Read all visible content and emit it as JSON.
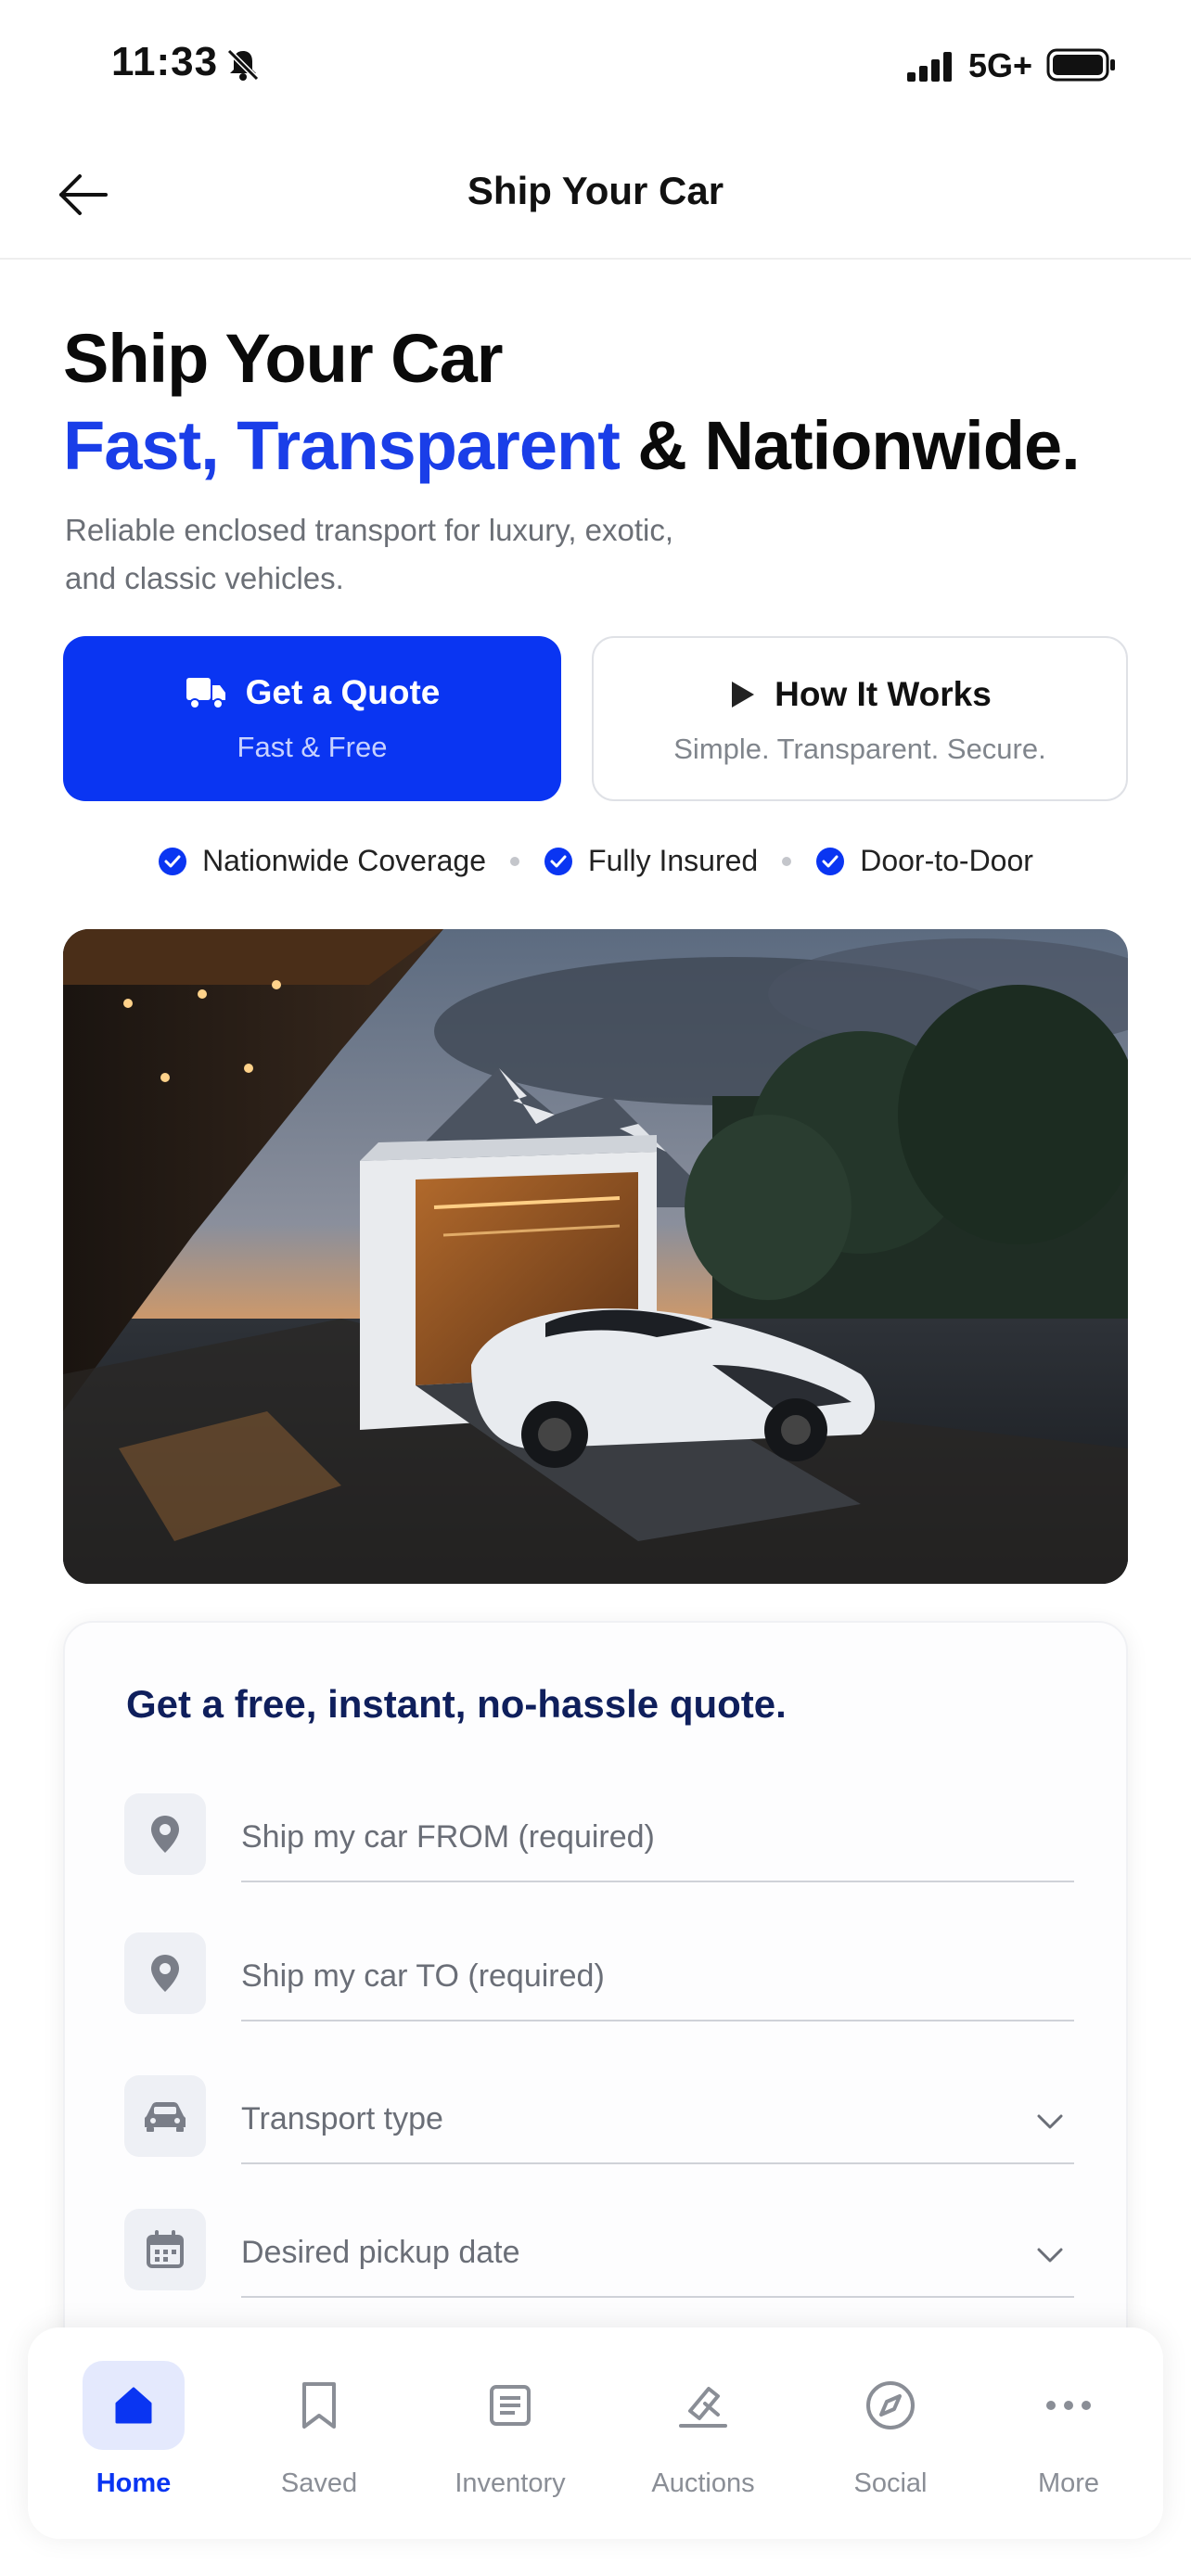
{
  "status": {
    "time": "11:33",
    "network": "5G+"
  },
  "nav": {
    "title": "Ship Your Car"
  },
  "hero": {
    "line1": "Ship Your Car",
    "line2_accent": "Fast, Transparent",
    "line2_rest": " & Nationwide.",
    "subtitle_line1": "Reliable enclosed transport for luxury, exotic,",
    "subtitle_line2": "and classic vehicles."
  },
  "cta": {
    "primary": {
      "label": "Get a Quote",
      "sub": "Fast & Free",
      "icon": "truck-icon"
    },
    "secondary": {
      "label": "How It Works",
      "sub": "Simple. Transparent. Secure.",
      "icon": "play-icon"
    }
  },
  "features": [
    "Nationwide Coverage",
    "Fully Insured",
    "Door-to-Door"
  ],
  "quote_form": {
    "title": "Get a free, instant, no-hassle quote.",
    "fields": [
      {
        "placeholder": "Ship my car FROM (required)",
        "icon": "location-pin-icon"
      },
      {
        "placeholder": "Ship my car TO (required)",
        "icon": "location-pin-icon"
      },
      {
        "placeholder": "Transport type",
        "icon": "car-icon"
      },
      {
        "placeholder": "Desired pickup date",
        "icon": "calendar-icon"
      }
    ]
  },
  "tabs": [
    {
      "label": "Home",
      "icon": "home-icon",
      "active": true
    },
    {
      "label": "Saved",
      "icon": "bookmark-icon"
    },
    {
      "label": "Inventory",
      "icon": "list-icon"
    },
    {
      "label": "Auctions",
      "icon": "gavel-icon"
    },
    {
      "label": "Social",
      "icon": "compass-icon"
    },
    {
      "label": "More",
      "icon": "more-icon"
    }
  ],
  "colors": {
    "accent": "#0a35f2",
    "title_accent": "#1a3ee8",
    "form_title": "#0f1f5c"
  }
}
